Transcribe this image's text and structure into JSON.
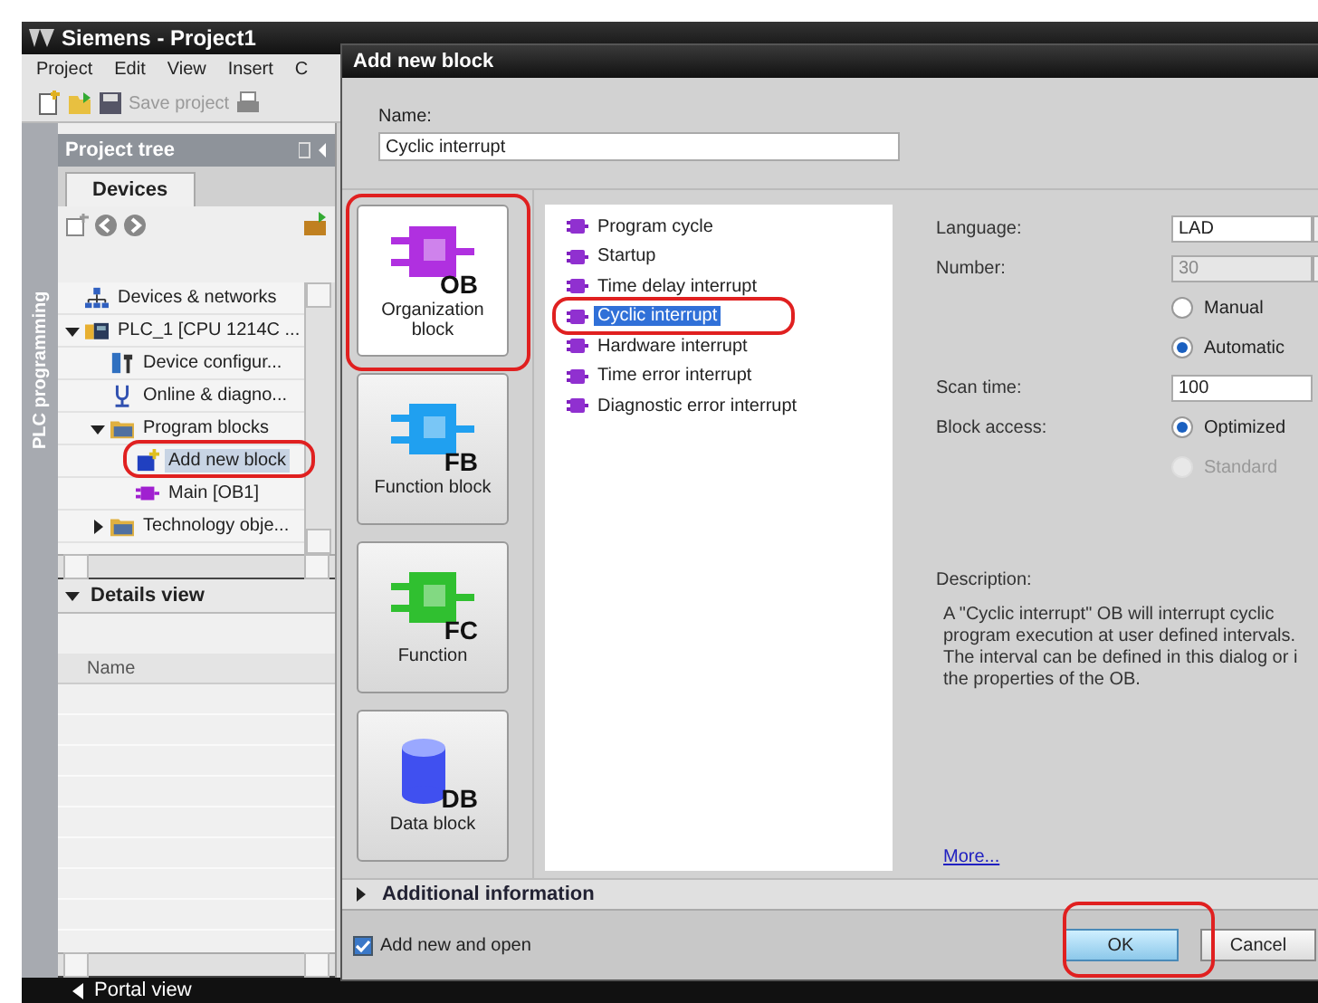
{
  "app": {
    "title": "Siemens  -  Project1",
    "menu": [
      "Project",
      "Edit",
      "View",
      "Insert",
      "C"
    ],
    "toolbar": {
      "save_label": "Save project",
      "save_disabled": true
    },
    "side_tab": "PLC programming",
    "project_tree": {
      "title": "Project tree",
      "tab": "Devices",
      "items": [
        {
          "label": "Devices & networks",
          "kind": "network",
          "selected": false
        },
        {
          "label": "PLC_1 [CPU 1214C ...",
          "kind": "plc",
          "selected": false,
          "expanded": true,
          "children": [
            {
              "label": "Device configur...",
              "kind": "config",
              "selected": false
            },
            {
              "label": "Online & diagno...",
              "kind": "online",
              "selected": false
            },
            {
              "label": "Program blocks",
              "kind": "folder",
              "selected": false,
              "expanded": true,
              "children": [
                {
                  "label": "Add new block",
                  "kind": "add",
                  "selected": true
                },
                {
                  "label": "Main [OB1]",
                  "kind": "block",
                  "selected": false
                }
              ]
            },
            {
              "label": "Technology obje...",
              "kind": "folder",
              "selected": false,
              "expanded": false
            }
          ]
        }
      ]
    },
    "details_view": {
      "title": "Details view",
      "column": "Name"
    },
    "portal_view": "Portal view"
  },
  "dialog": {
    "title": "Add new block",
    "name_label": "Name:",
    "name_value": "Cyclic interrupt",
    "block_types": [
      {
        "label": "Organization block",
        "code": "OB",
        "kind": "block",
        "color": "#b030e0",
        "selected": true
      },
      {
        "label": "Function block",
        "code": "FB",
        "kind": "block",
        "color": "#20a0f0",
        "selected": false
      },
      {
        "label": "Function",
        "code": "FC",
        "kind": "block",
        "color": "#30c030",
        "selected": false
      },
      {
        "label": "Data block",
        "code": "DB",
        "kind": "cylinder",
        "color": "#4050f0",
        "selected": false
      }
    ],
    "ob_types": [
      {
        "label": "Program cycle",
        "selected": false
      },
      {
        "label": "Startup",
        "selected": false
      },
      {
        "label": "Time delay interrupt",
        "selected": false
      },
      {
        "label": "Cyclic interrupt",
        "selected": true
      },
      {
        "label": "Hardware interrupt",
        "selected": false
      },
      {
        "label": "Time error interrupt",
        "selected": false
      },
      {
        "label": "Diagnostic error interrupt",
        "selected": false
      }
    ],
    "language": {
      "label": "Language:",
      "value": "LAD"
    },
    "number": {
      "label": "Number:",
      "value": "30",
      "disabled": true
    },
    "number_mode": [
      {
        "label": "Manual",
        "selected": false,
        "disabled": false
      },
      {
        "label": "Automatic",
        "selected": true,
        "disabled": false
      }
    ],
    "scan_time": {
      "label": "Scan time:",
      "value": "100"
    },
    "block_access": {
      "label": "Block access:",
      "options": [
        {
          "label": "Optimized",
          "selected": true,
          "disabled": false
        },
        {
          "label": "Standard",
          "selected": false,
          "disabled": true
        }
      ]
    },
    "description": {
      "label": "Description:",
      "lines": [
        "A \"Cyclic interrupt\" OB will interrupt cyclic",
        "program execution at user defined intervals.",
        "The interval can be defined in this dialog or i",
        "the properties of the OB."
      ]
    },
    "more_link": "More...",
    "additional_info": {
      "label": "Additional  information",
      "expanded": false
    },
    "add_and_open": {
      "label": "Add new and open",
      "checked": true
    },
    "buttons": [
      {
        "label": "OK",
        "kind": "primary"
      },
      {
        "label": "Cancel",
        "kind": "normal"
      }
    ]
  }
}
